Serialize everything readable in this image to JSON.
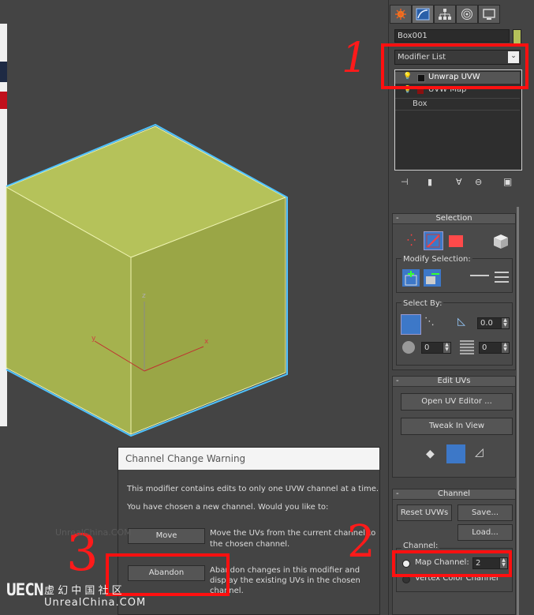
{
  "command_panel": {
    "tabs": [
      "create-icon",
      "modify-icon",
      "hierarchy-icon",
      "motion-icon",
      "display-icon"
    ],
    "object_name": "Box001",
    "modifier_list_label": "Modifier List",
    "stack": [
      "Unwrap UVW",
      "UVW Map",
      "Box"
    ]
  },
  "selection_rollout": {
    "title": "Selection",
    "modify_selection_label": "Modify Selection:",
    "select_by_label": "Select By:",
    "spinner_a": "0.0",
    "spinner_b": "0",
    "spinner_c": "0"
  },
  "edit_uvs_rollout": {
    "title": "Edit UVs",
    "open_uv_editor": "Open UV Editor ...",
    "tweak_in_view": "Tweak In View"
  },
  "channel_rollout": {
    "title": "Channel",
    "reset_uvws": "Reset UVWs",
    "save": "Save...",
    "load": "Load...",
    "channel_group_label": "Channel:",
    "map_channel_label": "Map Channel:",
    "map_channel_value": "2",
    "vertex_color_channel_label": "Vertex Color Channel"
  },
  "dialog": {
    "title": "Channel Change Warning",
    "line1": "This modifier contains edits to only one UVW channel at a time.",
    "line2": "You have chosen a new channel. Would you like to:",
    "move_button": "Move",
    "move_desc_1": "Move the UVs from the current channel to",
    "move_desc_2": "the chosen channel.",
    "abandon_button": "Abandon",
    "abandon_desc_1": "Abandon changes in this modifier and",
    "abandon_desc_2": "display the existing UVs in the chosen",
    "abandon_desc_3": "channel."
  },
  "viewport": {
    "axis_z": "z",
    "axis_x": "x",
    "axis_y": "y",
    "box_color": "#b4c05a"
  },
  "annotations": {
    "n1": "1",
    "n2": "2",
    "n3": "3",
    "color": "#ff1010"
  },
  "watermark": {
    "text_top": "UnrealChina.COM",
    "logo": "UECN",
    "chinese": "虚 幻 中 国 社 区",
    "url": "UnrealChina.COM"
  }
}
